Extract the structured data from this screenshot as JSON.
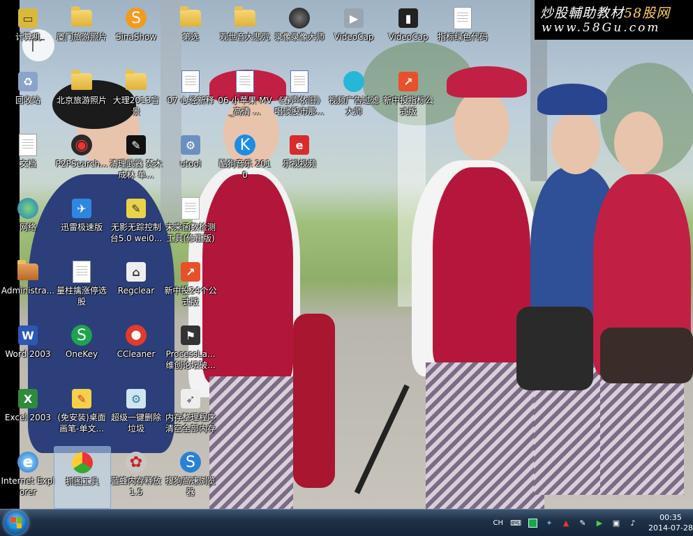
{
  "watermark": {
    "line1_a": "炒股輔助教材",
    "line1_b": "58股网",
    "line2": "www.58Gu.com"
  },
  "desktop_icons": [
    {
      "label": "计算机",
      "icon": "computer-icon"
    },
    {
      "label": "厦门旅游照片",
      "icon": "folder-icon"
    },
    {
      "label": "SinaShow",
      "icon": "sinashow-icon"
    },
    {
      "label": "第选",
      "icon": "folder-icon"
    },
    {
      "label": "观世音大悲咒",
      "icon": "folder-icon"
    },
    {
      "label": "录像录像大师",
      "icon": "recorder-icon"
    },
    {
      "label": "VideoCap",
      "icon": "videocap-icon"
    },
    {
      "label": "VideoCap",
      "icon": "videocap-shortcut-icon"
    },
    {
      "label": "指标绿色代码",
      "icon": "document-icon"
    },
    {
      "label": "回收站",
      "icon": "recycle-bin-icon"
    },
    {
      "label": "北京旅游照片",
      "icon": "folder-icon"
    },
    {
      "label": "大理2013盲景",
      "icon": "folder-icon"
    },
    {
      "label": "07 心经新释",
      "icon": "media-file-icon"
    },
    {
      "label": "06 小苹果 MV_高清 ...",
      "icon": "media-file-icon"
    },
    {
      "label": "《春声依旧》 唱谈股市那...",
      "icon": "media-file-icon"
    },
    {
      "label": "视频广告过滤大师",
      "icon": "video-filter-icon"
    },
    {
      "label": "新中投指标公式版",
      "icon": "chart-app-icon"
    },
    {
      "label": "文档",
      "icon": "documents-icon"
    },
    {
      "label": "P2PSearch...",
      "icon": "p2psearch-icon"
    },
    {
      "label": "清理武器 焚木成林 单...",
      "icon": "cleaner-icon"
    },
    {
      "label": "utool",
      "icon": "utool-icon"
    },
    {
      "label": "酷狗音乐 2010",
      "icon": "kugou-icon"
    },
    {
      "label": "乐视视频",
      "icon": "letv-icon"
    },
    {
      "label": "网络",
      "icon": "network-icon"
    },
    {
      "label": "迅雷极速版",
      "icon": "thunder-icon"
    },
    {
      "label": "无影无踪控制台5.0 wei0...",
      "icon": "console-icon"
    },
    {
      "label": "未来函数检测工具(修正版)",
      "icon": "tool-icon"
    },
    {
      "label": "Administra...",
      "icon": "user-folder-icon"
    },
    {
      "label": "量柱擒涨停选股",
      "icon": "document-icon"
    },
    {
      "label": "Regclear",
      "icon": "regclear-icon"
    },
    {
      "label": "新中投24个公式版",
      "icon": "chart-app-icon"
    },
    {
      "label": "Word 2003",
      "icon": "word-icon"
    },
    {
      "label": "OneKey",
      "icon": "onekey-icon"
    },
    {
      "label": "CCleaner",
      "icon": "ccleaner-icon"
    },
    {
      "label": "ProcessLa... 维创论坛破...",
      "icon": "processlasso-icon"
    },
    {
      "label": "Excel 2003",
      "icon": "excel-icon"
    },
    {
      "label": "(免安装)桌面画笔-单文...",
      "icon": "paint-icon"
    },
    {
      "label": "超级一键删除垃圾",
      "icon": "delete-icon"
    },
    {
      "label": "内存整理程序 清空全部内存",
      "icon": "rocket-icon"
    },
    {
      "label": "Internet Explorer",
      "icon": "ie-icon"
    },
    {
      "label": "抓图工具",
      "icon": "capture-icon"
    },
    {
      "label": "蓝蜂内存释放1.5",
      "icon": "memory-icon"
    },
    {
      "label": "搜狗高速浏览器",
      "icon": "sogou-icon"
    }
  ],
  "taskbar": {
    "language": "CH",
    "time": "00:35",
    "date": "2014-07-28",
    "tray_icons": [
      "keyboard-icon",
      "green-square-icon",
      "network-app-icon",
      "arrow-icon",
      "pen-icon",
      "play-icon",
      "monitor-icon",
      "volume-icon"
    ]
  },
  "colors": {
    "taskbar": "#1f3148",
    "start_orb": "#1a6fc1",
    "watermark_bg": "#000000",
    "watermark_accent": "#ffd166"
  }
}
